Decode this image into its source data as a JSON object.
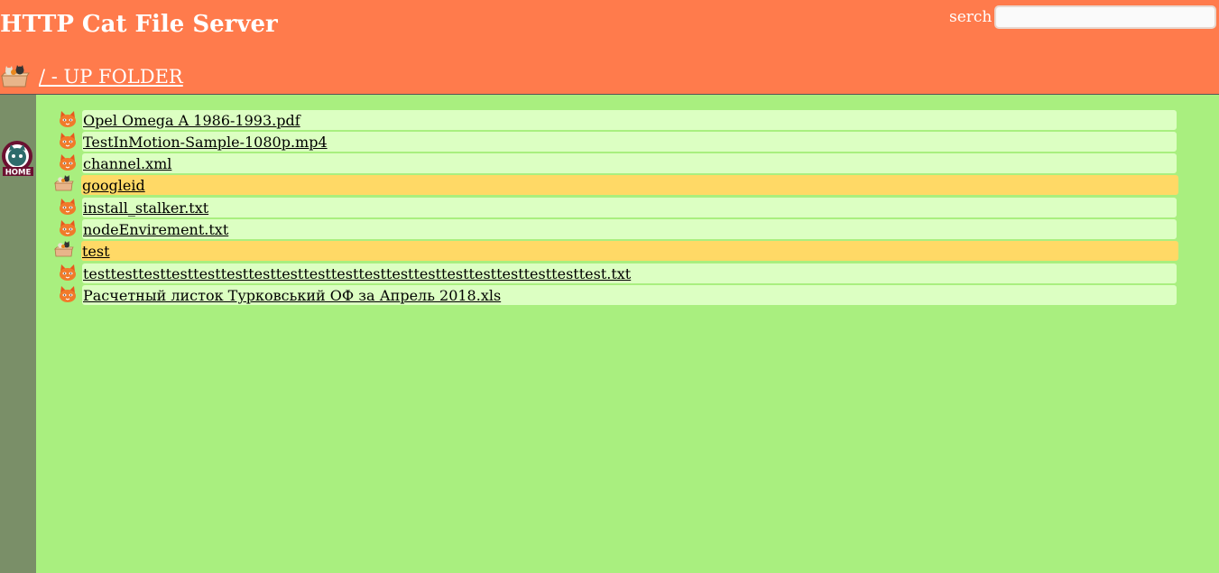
{
  "header": {
    "title": "HTTP Cat File Server",
    "search_label": "serch",
    "search_value": "",
    "up_folder_label": "/ - UP FOLDER",
    "bg_color": "#ff7b4c"
  },
  "sidebar": {
    "home_label": "HOME"
  },
  "colors": {
    "page_bg": "#a9ef7f",
    "file_row_bg": "#dcffc2",
    "folder_row_bg": "#ffd966",
    "sidebar_bg": "#7a8f68"
  },
  "files": [
    {
      "name": "Opel Omega A 1986-1993.pdf",
      "type": "file",
      "icon": "cat-file-icon"
    },
    {
      "name": "TestInMotion-Sample-1080p.mp4",
      "type": "file",
      "icon": "cat-file-icon"
    },
    {
      "name": "channel.xml",
      "type": "file",
      "icon": "cat-file-icon"
    },
    {
      "name": "googleid",
      "type": "folder",
      "icon": "cat-box-folder-icon"
    },
    {
      "name": "install_stalker.txt",
      "type": "file",
      "icon": "cat-file-icon"
    },
    {
      "name": "nodeEnvirement.txt",
      "type": "file",
      "icon": "cat-file-icon"
    },
    {
      "name": "test",
      "type": "folder",
      "icon": "cat-box-folder-icon"
    },
    {
      "name": "testtesttesttesttesttesttesttesttesttesttesttesttesttesttesttesttesttesttest.txt",
      "type": "file",
      "icon": "cat-file-icon"
    },
    {
      "name": "Расчетный листок Турковський ОФ за Апрель 2018.xls",
      "type": "file",
      "icon": "cat-file-icon"
    }
  ]
}
